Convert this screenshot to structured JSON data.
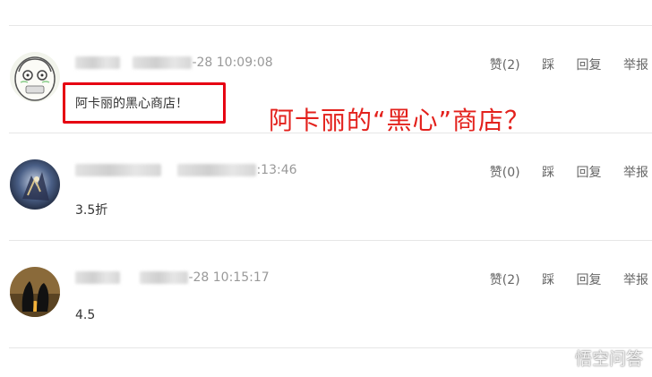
{
  "comments": [
    {
      "timestamp": "-28 10:09:08",
      "content": "阿卡丽的黑心商店！",
      "actions": {
        "like": "赞(2)",
        "dislike": "踩",
        "reply": "回复",
        "report": "举报"
      }
    },
    {
      "timestamp": ":13:46",
      "content": "3.5折",
      "actions": {
        "like": "赞(0)",
        "dislike": "踩",
        "reply": "回复",
        "report": "举报"
      }
    },
    {
      "timestamp": "-28 10:15:17",
      "content": "4.5",
      "actions": {
        "like": "赞(2)",
        "dislike": "踩",
        "reply": "回复",
        "report": "举报"
      }
    }
  ],
  "annotation": "阿卡丽的“黑心”商店？",
  "watermark": "悟空问答",
  "colors": {
    "highlight": "#e60012",
    "annotation": "#e3211c"
  }
}
